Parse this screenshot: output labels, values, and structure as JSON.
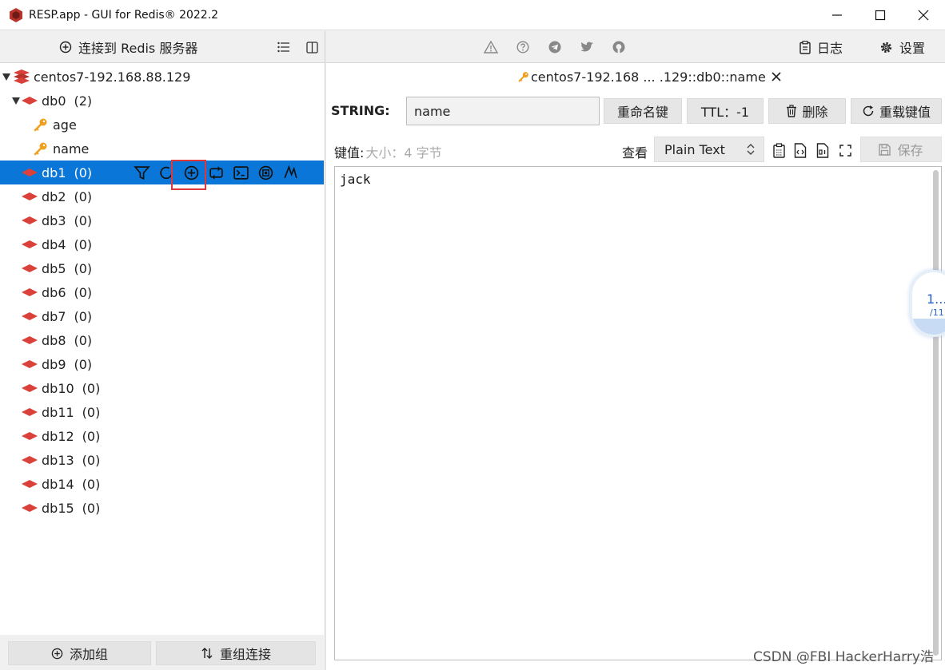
{
  "window": {
    "title": "RESP.app - GUI for Redis® 2022.2",
    "controls": [
      "minimize-icon",
      "maximize-icon",
      "close-icon"
    ]
  },
  "left_toolbar": {
    "connect_label": "连接到 Redis 服务器"
  },
  "tree": {
    "server": "centos7-192.168.88.129",
    "databases": [
      {
        "name": "db0",
        "count": "(2)",
        "expanded": true,
        "keys": [
          "age",
          "name"
        ]
      },
      {
        "name": "db1",
        "count": "(0)",
        "selected": true
      },
      {
        "name": "db2",
        "count": "(0)"
      },
      {
        "name": "db3",
        "count": "(0)"
      },
      {
        "name": "db4",
        "count": "(0)"
      },
      {
        "name": "db5",
        "count": "(0)"
      },
      {
        "name": "db6",
        "count": "(0)"
      },
      {
        "name": "db7",
        "count": "(0)"
      },
      {
        "name": "db8",
        "count": "(0)"
      },
      {
        "name": "db9",
        "count": "(0)"
      },
      {
        "name": "db10",
        "count": "(0)"
      },
      {
        "name": "db11",
        "count": "(0)"
      },
      {
        "name": "db12",
        "count": "(0)"
      },
      {
        "name": "db13",
        "count": "(0)"
      },
      {
        "name": "db14",
        "count": "(0)"
      },
      {
        "name": "db15",
        "count": "(0)"
      }
    ]
  },
  "left_bottom": {
    "add_group": "添加组",
    "regroup": "重组连接"
  },
  "right_toolbar": {
    "log_label": "日志",
    "settings_label": "设置"
  },
  "tab": {
    "label": "centos7-192.168 ... .129::db0::name"
  },
  "key": {
    "type_label": "STRING:",
    "name_value": "name",
    "rename_label": "重命名键",
    "ttl_label": "TTL：-1",
    "delete_label": "删除",
    "reload_label": "重载键值"
  },
  "value": {
    "label": "键值:",
    "size_text": "大小：4 字节",
    "view_label": "查看",
    "view_format": "Plain Text",
    "save_label": "保存",
    "content": "jack"
  },
  "badge": {
    "line1": "1...",
    "line2": "/11"
  },
  "watermark": "CSDN @FBI HackerHarry浩",
  "colors": {
    "selected_row": "#0a76d8",
    "db_icon": "#d9413a",
    "key_icon": "#f0a020",
    "highlight_box": "#e0383a"
  }
}
